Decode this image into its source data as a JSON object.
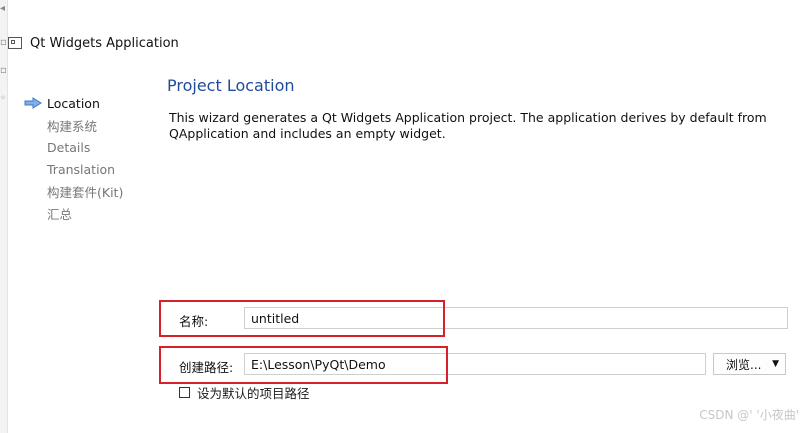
{
  "window": {
    "title": "Qt Widgets Application"
  },
  "steps": [
    {
      "label": "Location",
      "current": true
    },
    {
      "label": "构建系统",
      "current": false
    },
    {
      "label": "Details",
      "current": false
    },
    {
      "label": "Translation",
      "current": false
    },
    {
      "label": "构建套件(Kit)",
      "current": false
    },
    {
      "label": "汇总",
      "current": false
    }
  ],
  "page": {
    "title": "Project Location",
    "description": "This wizard generates a Qt Widgets Application project. The application derives by default from QApplication and includes an empty widget."
  },
  "form": {
    "name_label": "名称:",
    "name_value": "untitled",
    "path_label": "创建路径:",
    "path_value": "E:\\Lesson\\PyQt\\Demo",
    "browse_label": "浏览...",
    "default_path_label": "设为默认的项目路径",
    "default_path_checked": false
  },
  "highlight_color": "#d6202a",
  "watermark": "CSDN @' '小夜曲'"
}
